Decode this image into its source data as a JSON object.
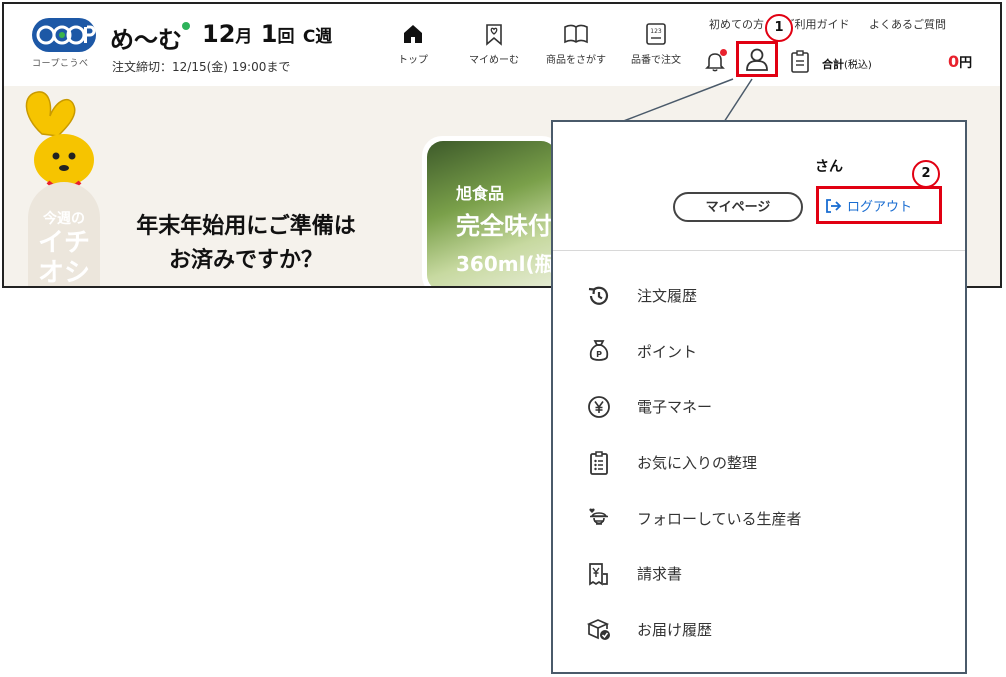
{
  "header": {
    "logo_text": "CO·OP",
    "logo_sub": "コープこうべ",
    "brand": "め〜む",
    "week_month_num": "12",
    "week_month_unit": "月",
    "week_num": "1",
    "week_unit": "回",
    "week_letter": "C週",
    "deadline": "注文締切：12/15(金) 19:00まで",
    "nav": [
      {
        "label": "トップ",
        "icon": "home-icon"
      },
      {
        "label": "マイめーむ",
        "icon": "bookmark-heart-icon"
      },
      {
        "label": "商品をさがす",
        "icon": "book-icon"
      },
      {
        "label": "品番で注文",
        "icon": "number-pad-icon"
      }
    ],
    "util_links": [
      "初めての方",
      "ご利用ガイド",
      "よくあるご質問"
    ],
    "total_label": "合計",
    "total_tax": "(税込)",
    "total_amount": "0",
    "total_unit": "円"
  },
  "hero": {
    "week_tab_line1": "今週の",
    "week_tab_line2": "イチ",
    "week_tab_line3": "オシ",
    "title_line1": "年末年始用にご準備は",
    "title_line2": "お済みですか？",
    "product_maker": "旭食品",
    "product_name": "完全味付",
    "product_size": "360ml(瓶"
  },
  "annotations": {
    "badge_1": "1",
    "badge_2": "2"
  },
  "dropdown": {
    "user_suffix": "さん",
    "mypage_label": "マイページ",
    "logout_label": "ログアウト",
    "menu": [
      {
        "label": "注文履歴",
        "icon": "history-icon"
      },
      {
        "label": "ポイント",
        "icon": "point-bag-icon"
      },
      {
        "label": "電子マネー",
        "icon": "yen-coin-icon"
      },
      {
        "label": "お気に入りの整理",
        "icon": "clipboard-list-icon"
      },
      {
        "label": "フォローしている生産者",
        "icon": "producer-icon"
      },
      {
        "label": "請求書",
        "icon": "invoice-icon"
      },
      {
        "label": "お届け履歴",
        "icon": "delivery-box-icon"
      }
    ]
  },
  "colors": {
    "highlight_red": "#e10012",
    "price_red": "#e8212d",
    "link_blue": "#1a6dd1",
    "coop_blue": "#1d58a6"
  }
}
